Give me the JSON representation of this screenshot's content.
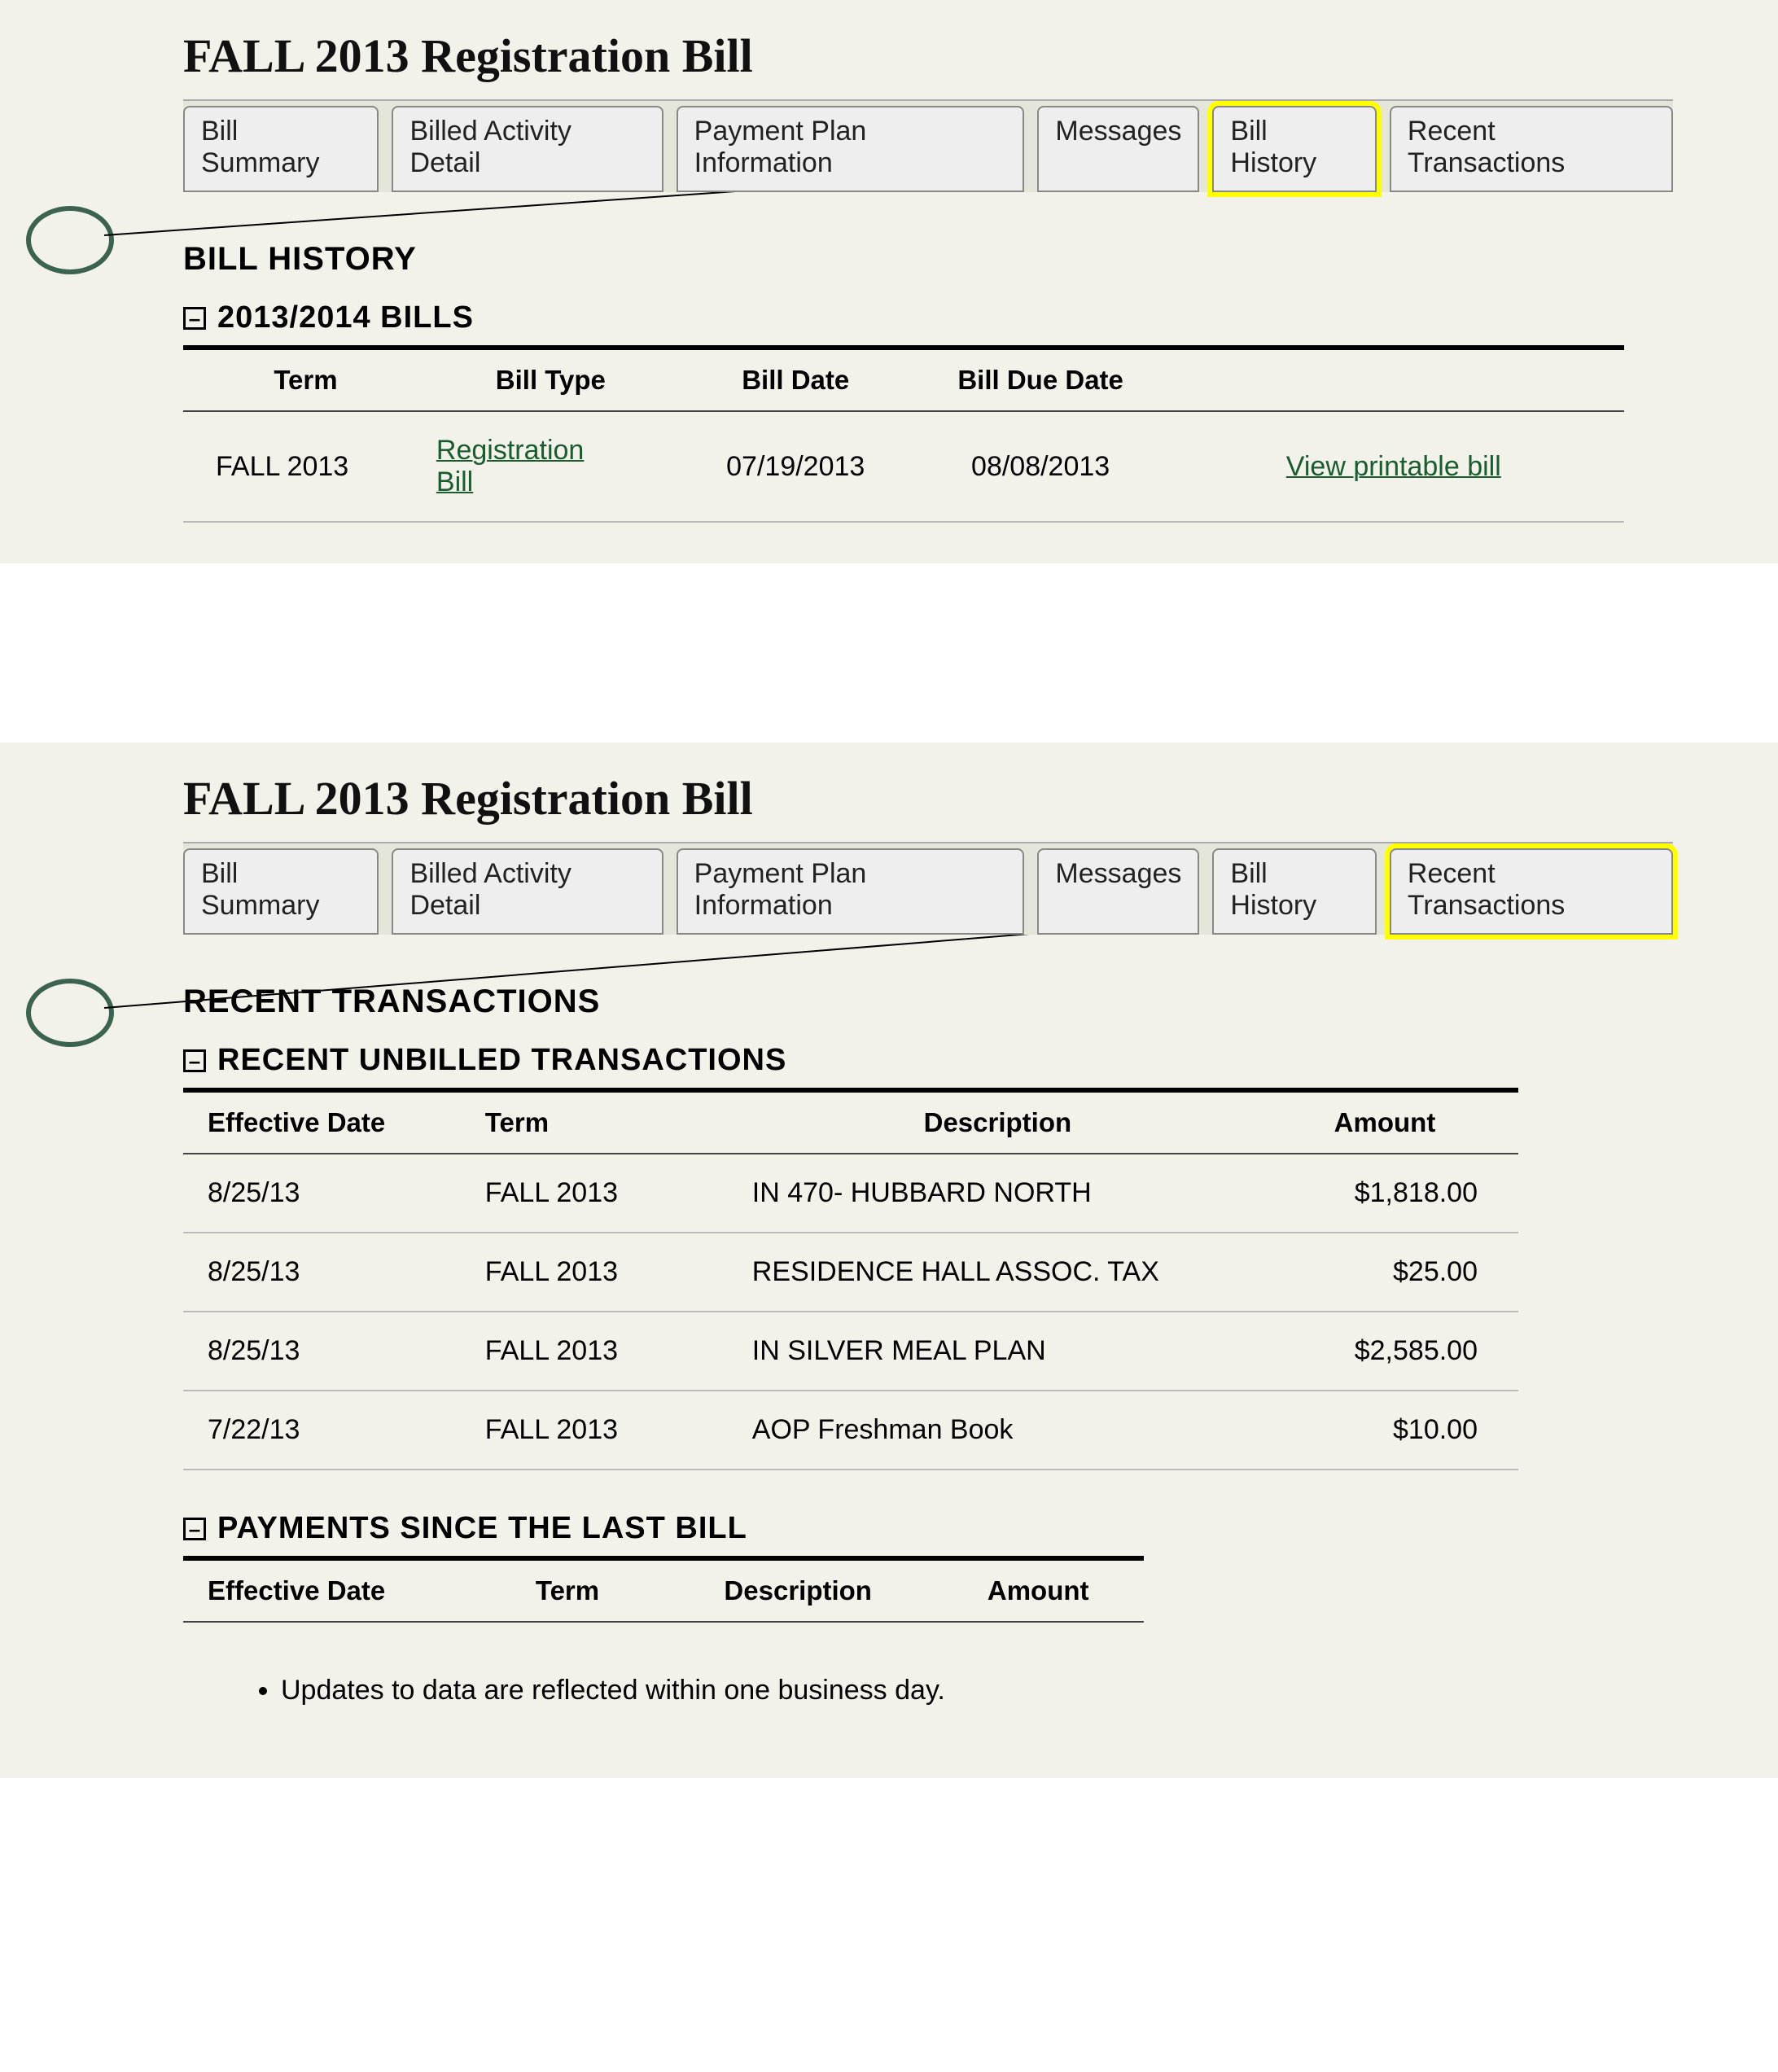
{
  "page_title": "FALL 2013 Registration Bill",
  "tabs": {
    "bill_summary": "Bill Summary",
    "billed_activity_detail": "Billed Activity Detail",
    "payment_plan_information": "Payment Plan Information",
    "messages": "Messages",
    "bill_history": "Bill History",
    "recent_transactions": "Recent Transactions"
  },
  "bill_history": {
    "heading": "BILL HISTORY",
    "subheading": "2013/2014 BILLS",
    "columns": {
      "term": "Term",
      "bill_type": "Bill Type",
      "bill_date": "Bill Date",
      "bill_due_date": "Bill Due Date"
    },
    "rows": [
      {
        "term": "FALL 2013",
        "bill_type": "Registration Bill",
        "bill_date": "07/19/2013",
        "bill_due_date": "08/08/2013",
        "action": "View printable bill"
      }
    ]
  },
  "recent_transactions": {
    "heading": "RECENT TRANSACTIONS",
    "unbilled_heading": "RECENT UNBILLED TRANSACTIONS",
    "columns": {
      "effective_date": "Effective Date",
      "term": "Term",
      "description": "Description",
      "amount": "Amount"
    },
    "rows": [
      {
        "effective_date": "8/25/13",
        "term": "FALL 2013",
        "description": "IN 470- HUBBARD NORTH",
        "amount": "$1,818.00"
      },
      {
        "effective_date": "8/25/13",
        "term": "FALL 2013",
        "description": "RESIDENCE HALL ASSOC. TAX",
        "amount": "$25.00"
      },
      {
        "effective_date": "8/25/13",
        "term": "FALL 2013",
        "description": "IN SILVER MEAL PLAN",
        "amount": "$2,585.00"
      },
      {
        "effective_date": "7/22/13",
        "term": "FALL 2013",
        "description": "AOP Freshman Book",
        "amount": "$10.00"
      }
    ],
    "payments_heading": "PAYMENTS SINCE THE LAST BILL",
    "payments_columns": {
      "effective_date": "Effective Date",
      "term": "Term",
      "description": "Description",
      "amount": "Amount"
    }
  },
  "notes": [
    "Updates to data are reflected within one business day."
  ],
  "minus_glyph": "–"
}
